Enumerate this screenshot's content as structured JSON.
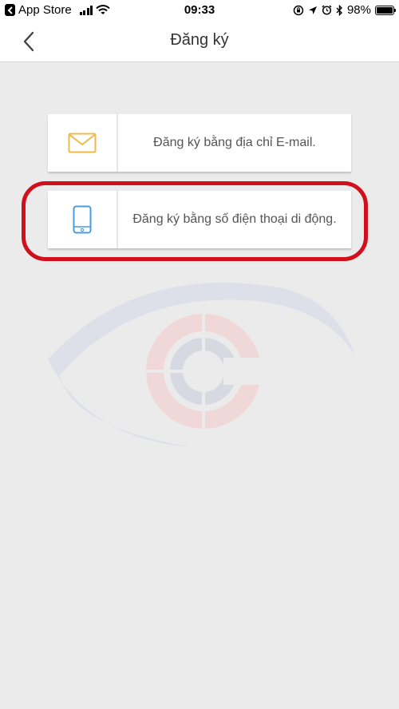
{
  "status_bar": {
    "back_app": "App Store",
    "time": "09:33",
    "battery": "98%",
    "battery_level": 0.98
  },
  "nav": {
    "title": "Đăng ký"
  },
  "options": [
    {
      "label": "Đăng ký bằng địa chỉ E-mail.",
      "icon": "mail-icon",
      "icon_color": "#f0b84a"
    },
    {
      "label": "Đăng ký bằng số điện thoại di động.",
      "icon": "mobile-phone-icon",
      "icon_color": "#4a9ee0"
    }
  ],
  "colors": {
    "highlight": "#d0101b",
    "background": "#ebebeb"
  }
}
